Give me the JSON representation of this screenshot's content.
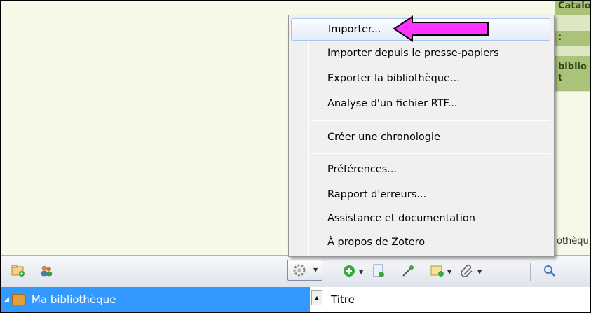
{
  "menu": {
    "items": [
      {
        "label": "Importer..."
      },
      {
        "label": "Importer depuis le presse-papiers"
      },
      {
        "label": "Exporter la bibliothèque..."
      },
      {
        "label": "Analyse d'un fichier RTF..."
      },
      {
        "label": "Créer une chronologie"
      },
      {
        "label": "Préférences..."
      },
      {
        "label": "Rapport d'erreurs..."
      },
      {
        "label": "Assistance et documentation"
      },
      {
        "label": "À propos de Zotero"
      }
    ]
  },
  "background": {
    "green_label_1": "Catalogue Crésus",
    "green_label_2": ":",
    "green_label_3": "biblio\nt",
    "cut_text": "othèqu"
  },
  "toolbar": {
    "icons": [
      "new-collection-icon",
      "new-group-icon",
      "gear-icon",
      "new-item-icon",
      "new-note-icon",
      "magic-wand-icon",
      "add-note-icon",
      "attachment-icon",
      "search-icon"
    ]
  },
  "library": {
    "label": "Ma bibliothèque"
  },
  "items_pane": {
    "column_title": "Titre"
  },
  "colors": {
    "menu_bg": "#f0f0f0",
    "selection": "#3399ff",
    "highlight_arrow": "#ff33ff",
    "green_label": "#aac379"
  }
}
